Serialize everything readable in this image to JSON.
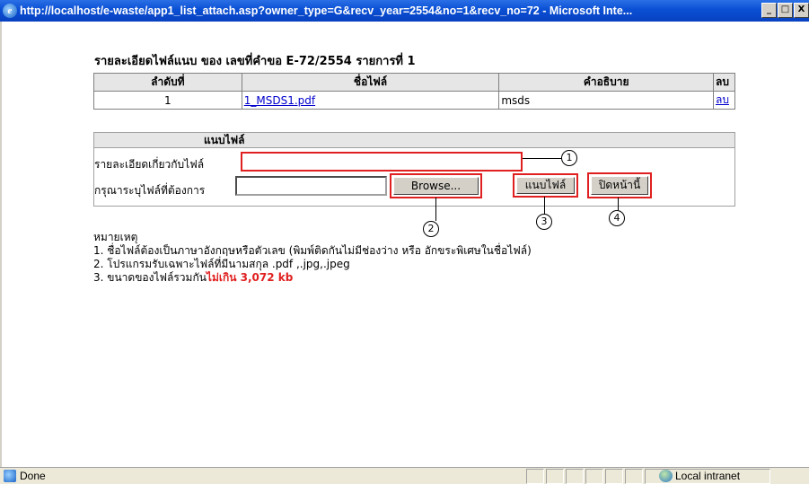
{
  "window": {
    "title": "http://localhost/e-waste/app1_list_attach.asp?owner_type=G&recv_year=2554&no=1&recv_no=72 - Microsoft Inte...",
    "minimize": "_",
    "maximize": "□",
    "close": "X"
  },
  "heading": "รายละเอียดไฟล์แนบ ของ เลขที่คำขอ E-72/2554 รายการที่ 1",
  "table": {
    "headers": [
      "ลำดับที่",
      "ชื่อไฟล์",
      "คำอธิบาย",
      "ลบ"
    ],
    "rows": [
      {
        "index": "1",
        "file": "1_MSDS1.pdf",
        "description": "msds",
        "delete": "ลบ"
      }
    ]
  },
  "form": {
    "title": "แนบไฟล์",
    "desc_label": "รายละเอียดเกี่ยวกับไฟล์",
    "desc_value": "",
    "file_label": "กรุณาระบุไฟล์ที่ต้องการ",
    "file_value": "",
    "browse_label": "Browse...",
    "attach_label": "แนบไฟล์",
    "close_label": "ปิดหน้านี้"
  },
  "callouts": [
    "1",
    "2",
    "3",
    "4"
  ],
  "notes": {
    "title": "หมายเหตุ",
    "line1": "1. ชื่อไฟล์ต้องเป็นภาษาอังกฤษหรือตัวเลข (พิมพ์ติดกันไม่มีช่องว่าง หรือ อักขระพิเศษในชื่อไฟล์)",
    "line2": "2. โปรแกรมรับเฉพาะไฟล์ที่มีนามสกุล .pdf ,.jpg,.jpeg",
    "line3_prefix": "3. ขนาดของไฟล์รวมกัน",
    "line3_limit": "ไม่เกิน 3,072 kb"
  },
  "status": {
    "text": "Done",
    "zone": "Local intranet"
  },
  "colors": {
    "titlebar": "#0a4fd4",
    "highlight_red": "#e02020",
    "link": "#0000cc"
  }
}
